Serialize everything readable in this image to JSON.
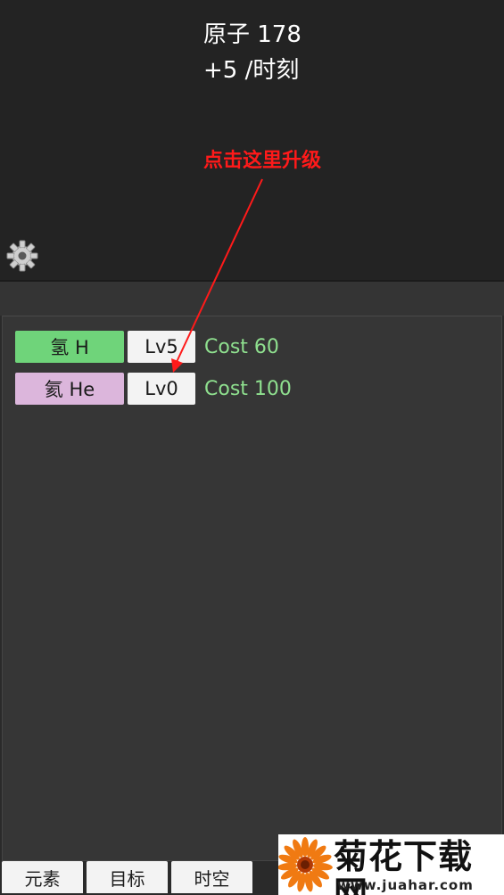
{
  "header": {
    "atoms": "原子 178",
    "rate": "+5 /时刻"
  },
  "annotation": {
    "hint": "点击这里升级",
    "color": "#ff1a1a"
  },
  "settings": {
    "icon": "gear-icon"
  },
  "elements": [
    {
      "name": "氢 H",
      "level": "Lv5",
      "cost": "Cost 60",
      "color": "#6fd47a"
    },
    {
      "name": "氦 He",
      "level": "Lv0",
      "cost": "Cost 100",
      "color": "#dcb6dc"
    }
  ],
  "tabs": [
    "元素",
    "目标",
    "时空"
  ],
  "watermark": {
    "title": "菊花下载网",
    "url": "www.juahar.com"
  }
}
